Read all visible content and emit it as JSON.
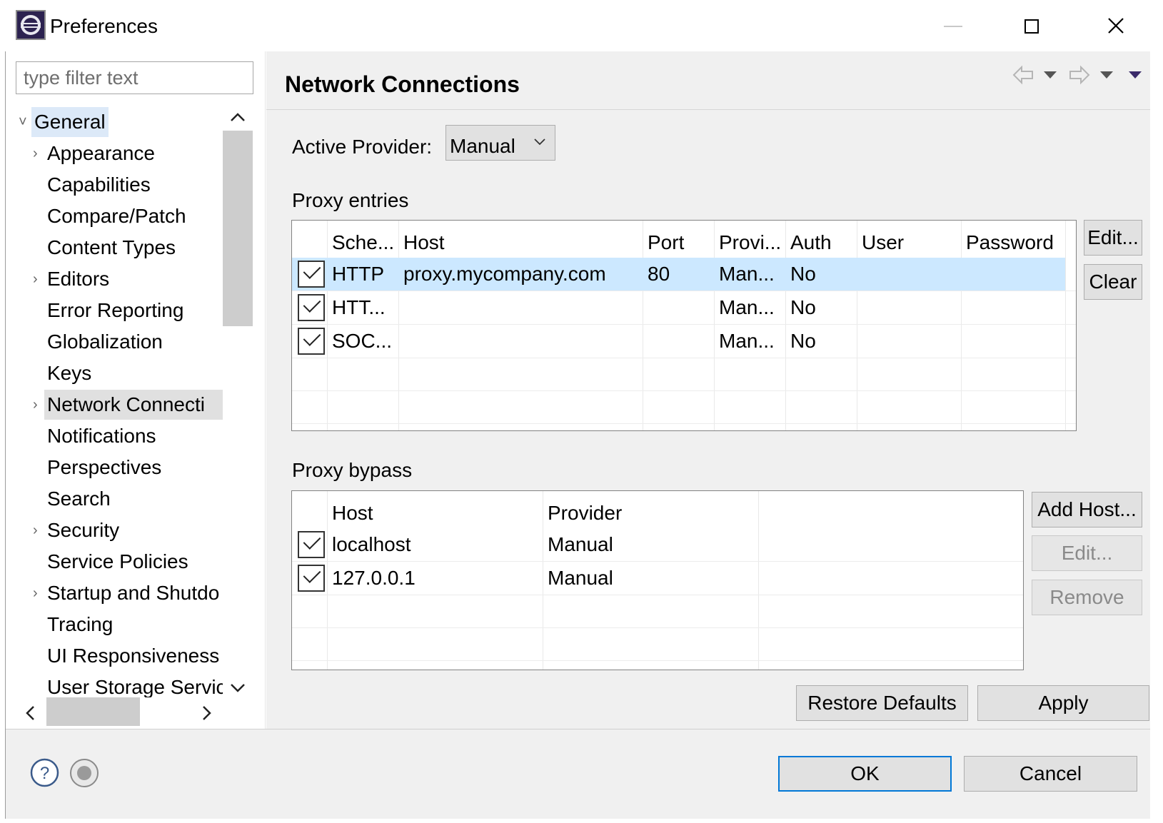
{
  "window": {
    "title": "Preferences"
  },
  "filter": {
    "placeholder": "type filter text"
  },
  "tree": {
    "items": [
      {
        "label": "General"
      },
      {
        "label": "Appearance"
      },
      {
        "label": "Capabilities"
      },
      {
        "label": "Compare/Patch"
      },
      {
        "label": "Content Types"
      },
      {
        "label": "Editors"
      },
      {
        "label": "Error Reporting"
      },
      {
        "label": "Globalization"
      },
      {
        "label": "Keys"
      },
      {
        "label": "Network Connecti"
      },
      {
        "label": "Notifications"
      },
      {
        "label": "Perspectives"
      },
      {
        "label": "Search"
      },
      {
        "label": "Security"
      },
      {
        "label": "Service Policies"
      },
      {
        "label": "Startup and Shutdo"
      },
      {
        "label": "Tracing"
      },
      {
        "label": "UI Responsiveness"
      },
      {
        "label": "User Storage Servic"
      }
    ]
  },
  "page": {
    "title": "Network Connections"
  },
  "provider": {
    "label": "Active Provider:",
    "value": "Manual"
  },
  "proxy_entries": {
    "label": "Proxy entries",
    "columns": [
      "Sche...",
      "Host",
      "Port",
      "Provi...",
      "Auth",
      "User",
      "Password"
    ],
    "rows": [
      {
        "checked": true,
        "scheme": "HTTP",
        "host": "proxy.mycompany.com",
        "port": "80",
        "provider": "Man...",
        "auth": "No",
        "user": "",
        "password": ""
      },
      {
        "checked": true,
        "scheme": "HTT...",
        "host": "",
        "port": "",
        "provider": "Man...",
        "auth": "No",
        "user": "",
        "password": ""
      },
      {
        "checked": true,
        "scheme": "SOC...",
        "host": "",
        "port": "",
        "provider": "Man...",
        "auth": "No",
        "user": "",
        "password": ""
      }
    ],
    "buttons": {
      "edit": "Edit...",
      "clear": "Clear"
    }
  },
  "proxy_bypass": {
    "label": "Proxy bypass",
    "columns": [
      "Host",
      "Provider"
    ],
    "rows": [
      {
        "checked": true,
        "host": "localhost",
        "provider": "Manual"
      },
      {
        "checked": true,
        "host": "127.0.0.1",
        "provider": "Manual"
      }
    ],
    "buttons": {
      "add_host": "Add Host...",
      "edit": "Edit...",
      "remove": "Remove"
    }
  },
  "actions": {
    "restore_defaults": "Restore Defaults",
    "apply": "Apply"
  },
  "dialog": {
    "ok": "OK",
    "cancel": "Cancel"
  },
  "colors": {
    "selection": "#cce8ff",
    "tree_selection": "#dce9f8",
    "default_button_border": "#0078d7",
    "pane_bg": "#f0f0f0"
  },
  "icons": [
    "eclipse-app-icon",
    "minimize-icon",
    "maximize-icon",
    "close-icon",
    "back-arrow-icon",
    "forward-arrow-icon",
    "view-menu-icon",
    "help-icon",
    "record-icon",
    "check-icon"
  ]
}
